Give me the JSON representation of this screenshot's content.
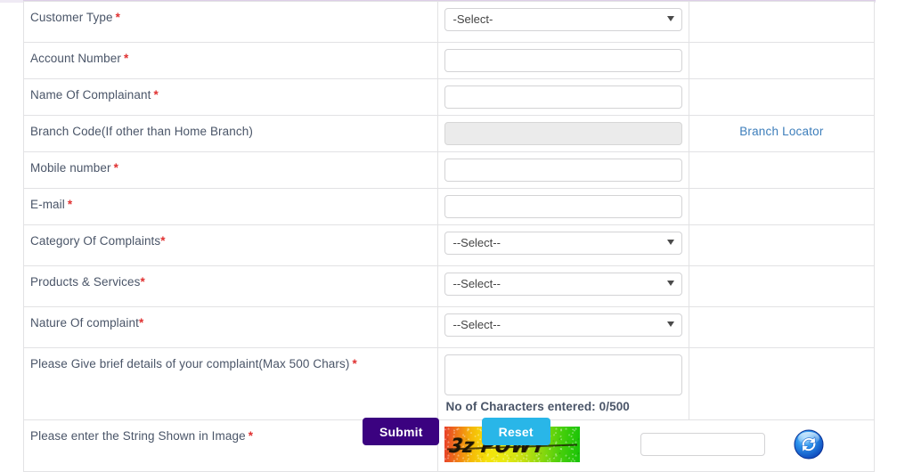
{
  "form": {
    "rows": [
      {
        "label": "Customer Type",
        "required": true,
        "required_spaced": true,
        "control": "select",
        "value": "-Select-",
        "extra": ""
      },
      {
        "label": "Account Number",
        "required": true,
        "required_spaced": true,
        "control": "text",
        "value": "",
        "extra": ""
      },
      {
        "label": "Name Of Complainant",
        "required": true,
        "required_spaced": true,
        "control": "text",
        "value": "",
        "extra": ""
      },
      {
        "label": "Branch Code(If other than Home Branch)",
        "required": false,
        "required_spaced": false,
        "control": "text-disabled",
        "value": "",
        "extra": "Branch Locator"
      },
      {
        "label": "Mobile number",
        "required": true,
        "required_spaced": true,
        "control": "text",
        "value": "",
        "extra": ""
      },
      {
        "label": "E-mail",
        "required": true,
        "required_spaced": true,
        "control": "text",
        "value": "",
        "extra": ""
      },
      {
        "label": "Category Of Complaints",
        "required": true,
        "required_spaced": false,
        "control": "select",
        "value": "--Select--",
        "extra": ""
      },
      {
        "label": "Products & Services",
        "required": true,
        "required_spaced": false,
        "control": "select",
        "value": "--Select--",
        "extra": ""
      },
      {
        "label": "Nature Of complaint",
        "required": true,
        "required_spaced": false,
        "control": "select",
        "value": "--Select--",
        "extra": ""
      }
    ],
    "details_row": {
      "label": "Please Give brief details of your complaint(Max 500 Chars)",
      "required": true,
      "value": "",
      "char_counter": "No of Characters entered: 0/500"
    },
    "captcha_row": {
      "label": "Please enter the String Shown in Image",
      "required": true,
      "captcha_text": "3z POWY",
      "input_value": "",
      "refresh_icon": "refresh-icon"
    }
  },
  "buttons": {
    "submit": "Submit",
    "reset": "Reset"
  },
  "colors": {
    "submit_bg": "#3b0280",
    "reset_bg": "#29b6e8",
    "required_asterisk": "#e03131",
    "link": "#3d7ebb",
    "label_text": "#4a5568",
    "border": "#e2e2e4"
  }
}
